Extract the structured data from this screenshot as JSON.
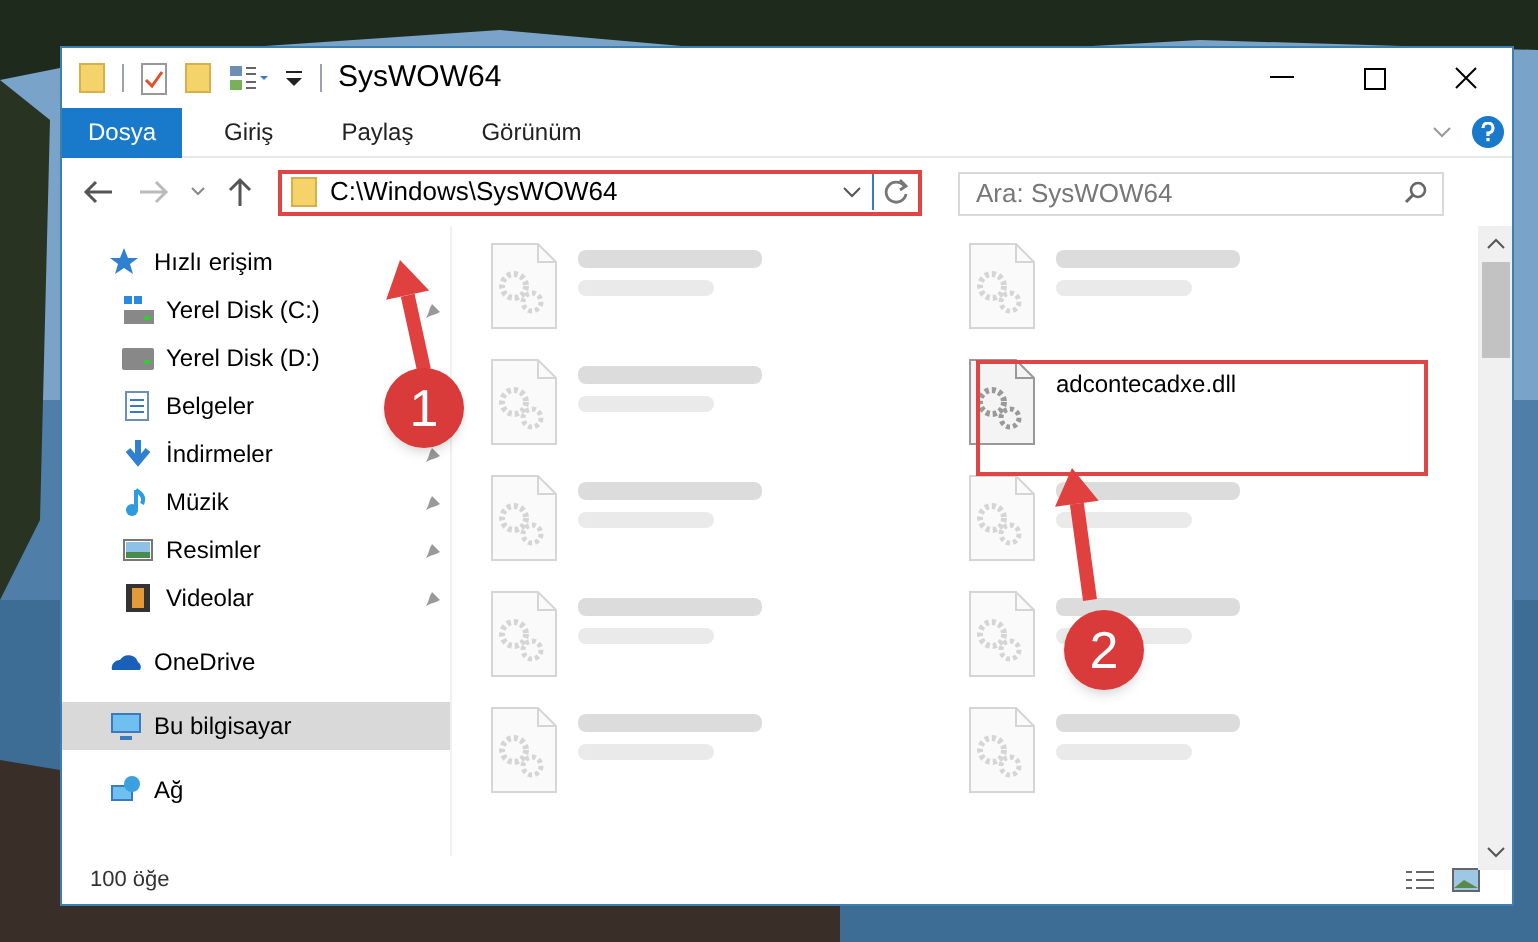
{
  "window": {
    "title": "SysWOW64"
  },
  "tabs": [
    {
      "label": "Dosya",
      "selected": true
    },
    {
      "label": "Giriş",
      "selected": false
    },
    {
      "label": "Paylaş",
      "selected": false
    },
    {
      "label": "Görünüm",
      "selected": false
    }
  ],
  "address": {
    "path": "C:\\Windows\\SysWOW64"
  },
  "search": {
    "placeholder": "Ara: SysWOW64"
  },
  "sidebar": {
    "items": [
      {
        "label": "Hızlı erişim",
        "kind": "quick",
        "selected": false,
        "children": [
          {
            "label": "Yerel Disk (C:)",
            "kind": "disk-c",
            "pinned": true
          },
          {
            "label": "Yerel Disk (D:)",
            "kind": "disk",
            "pinned": false
          },
          {
            "label": "Belgeler",
            "kind": "docs",
            "pinned": false
          },
          {
            "label": "İndirmeler",
            "kind": "download",
            "pinned": true
          },
          {
            "label": "Müzik",
            "kind": "music",
            "pinned": true
          },
          {
            "label": "Resimler",
            "kind": "pictures",
            "pinned": true
          },
          {
            "label": "Videolar",
            "kind": "videos",
            "pinned": true
          }
        ]
      },
      {
        "label": "OneDrive",
        "kind": "cloud",
        "selected": false
      },
      {
        "label": "Bu bilgisayar",
        "kind": "pc",
        "selected": true
      },
      {
        "label": "Ağ",
        "kind": "network",
        "selected": false
      }
    ]
  },
  "files": [
    {
      "blurred": true
    },
    {
      "blurred": true
    },
    {
      "blurred": true
    },
    {
      "name": "adcontecadxe.dll",
      "blurred": false
    },
    {
      "blurred": true
    },
    {
      "blurred": true
    },
    {
      "blurred": true
    },
    {
      "blurred": true
    },
    {
      "blurred": true
    },
    {
      "blurred": true
    }
  ],
  "status_bar": {
    "count": "100 öğe"
  },
  "annotations": [
    {
      "number": "1"
    },
    {
      "number": "2"
    }
  ]
}
